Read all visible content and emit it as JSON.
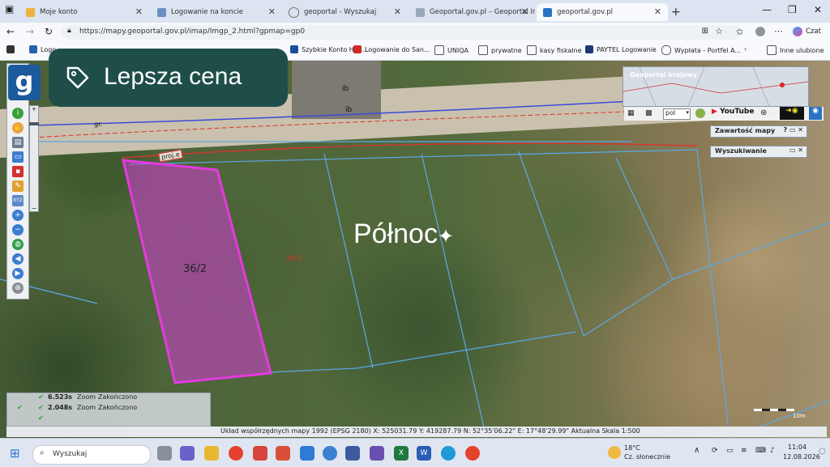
{
  "browser": {
    "tabs": [
      {
        "label": "Moje konto"
      },
      {
        "label": "Logowanie na koncie"
      },
      {
        "label": "geoportal - Wyszukaj"
      },
      {
        "label": "Geoportal.gov.pl – Geoportal Infra..."
      },
      {
        "label": "geoportal.gov.pl"
      }
    ],
    "new_tab": "+",
    "url": "https://mapy.geoportal.gov.pl/imap/Imgp_2.html?gpmap=gp0",
    "copilot_label": "Czat"
  },
  "bookmarks": [
    {
      "label": "Logo"
    },
    {
      "label": "Szybkie Konto Han..."
    },
    {
      "label": "Logowanie do San..."
    },
    {
      "label": "UNIQA"
    },
    {
      "label": "prywatne"
    },
    {
      "label": "kasy fiskalne"
    },
    {
      "label": "PAYTEL Logowanie"
    },
    {
      "label": "Wypłata - Portfel A..."
    },
    {
      "label": "Inne ulubione"
    }
  ],
  "overlay": {
    "badge_text": "Lepsza cena",
    "watermark": "Północ",
    "logo_letter": "g"
  },
  "map": {
    "parcel_label": "36/2",
    "parcel_label_red": "36/2",
    "road_label": "proj.e",
    "label_gr": "gr.",
    "label_ib1": "ib",
    "label_ib2": "ib",
    "overview_title": "Geoportal krajowy",
    "language": "pol",
    "youtube": "YouTube",
    "panel_contents": "Zawartość mapy",
    "panel_search": "Wyszukiwanie",
    "scale_label": "10m",
    "status_rows": [
      {
        "time": "6.523s",
        "zoom": "Zoom",
        "state": "Zakończono"
      },
      {
        "time": "2.048s",
        "zoom": "Zoom",
        "state": "Zakończono"
      },
      {
        "time": "",
        "zoom": "",
        "state": ""
      }
    ],
    "coords": "Układ współrzędnych mapy 1992 (EPSG 2180)   X: 525031.79  Y: 419287.79     N: 52°35'06.22\"  E: 17°48'29.99\"   Aktualna Skala 1:500"
  },
  "taskbar": {
    "search": "Wyszukaj",
    "weather_temp": "18°C",
    "weather_desc": "Cz. słonecznie",
    "time": "11:04",
    "date": "12.08.2026"
  },
  "colors": {
    "parcel": "#d43bd6",
    "badge": "#1f4e48",
    "boundary": "#5ba8e8",
    "road_line": "#e03030"
  }
}
